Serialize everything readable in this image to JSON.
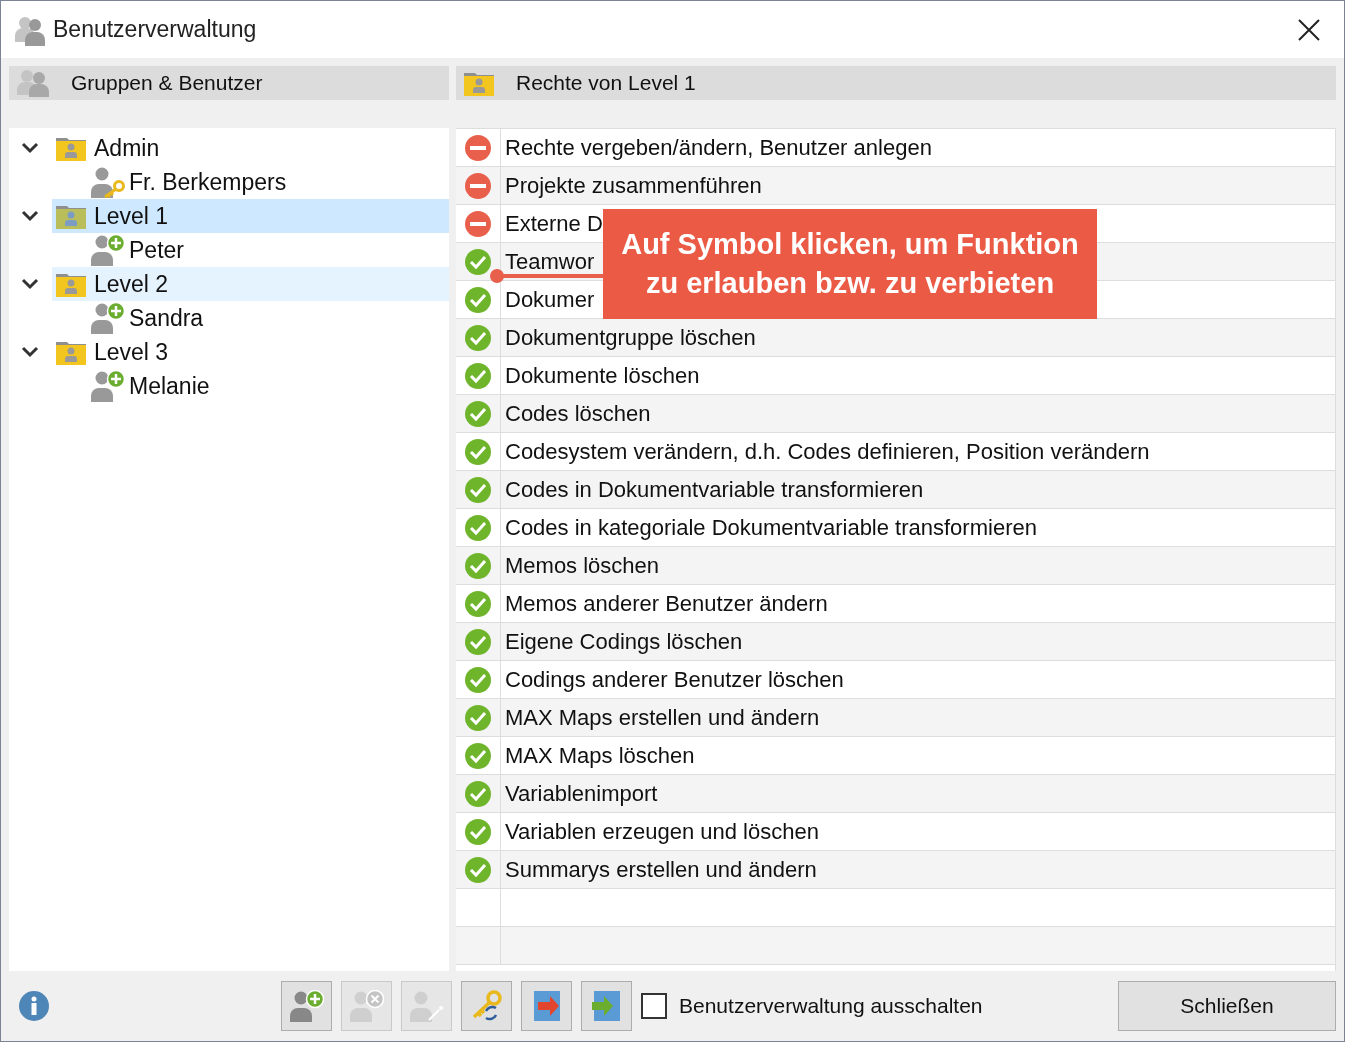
{
  "window": {
    "title": "Benutzerverwaltung"
  },
  "left_panel": {
    "header": "Gruppen & Benutzer"
  },
  "tree": [
    {
      "label": "Admin",
      "expanded": true,
      "selected": false,
      "hovered": false,
      "children": [
        {
          "label": "Fr. Berkempers",
          "kind": "owner"
        }
      ]
    },
    {
      "label": "Level 1",
      "expanded": true,
      "selected": true,
      "hovered": false,
      "children": [
        {
          "label": "Peter",
          "kind": "user"
        }
      ]
    },
    {
      "label": "Level 2",
      "expanded": true,
      "selected": false,
      "hovered": true,
      "children": [
        {
          "label": "Sandra",
          "kind": "user"
        }
      ]
    },
    {
      "label": "Level 3",
      "expanded": true,
      "selected": false,
      "hovered": false,
      "children": [
        {
          "label": "Melanie",
          "kind": "user"
        }
      ]
    }
  ],
  "right_panel": {
    "header": "Rechte von Level 1"
  },
  "rights": [
    {
      "label": "Rechte vergeben/ändern, Benutzer anlegen",
      "allowed": false
    },
    {
      "label": "Projekte zusammenführen",
      "allowed": false
    },
    {
      "label": "Externe D",
      "allowed": false
    },
    {
      "label": "Teamwor",
      "allowed": true
    },
    {
      "label": "Dokumer",
      "allowed": true
    },
    {
      "label": "Dokumentgruppe löschen",
      "allowed": true
    },
    {
      "label": "Dokumente löschen",
      "allowed": true
    },
    {
      "label": "Codes löschen",
      "allowed": true
    },
    {
      "label": "Codesystem verändern, d.h. Codes definieren, Position verändern",
      "allowed": true
    },
    {
      "label": "Codes in Dokumentvariable transformieren",
      "allowed": true
    },
    {
      "label": "Codes in kategoriale Dokumentvariable transformieren",
      "allowed": true
    },
    {
      "label": "Memos löschen",
      "allowed": true
    },
    {
      "label": "Memos anderer Benutzer ändern",
      "allowed": true
    },
    {
      "label": "Eigene Codings löschen",
      "allowed": true
    },
    {
      "label": "Codings anderer Benutzer löschen",
      "allowed": true
    },
    {
      "label": "MAX Maps erstellen und ändern",
      "allowed": true
    },
    {
      "label": "MAX Maps löschen",
      "allowed": true
    },
    {
      "label": "Variablenimport",
      "allowed": true
    },
    {
      "label": "Variablen erzeugen und löschen",
      "allowed": true
    },
    {
      "label": "Summarys erstellen und ändern",
      "allowed": true
    }
  ],
  "callout": {
    "text": "Auf Symbol klicken, um Funktion zu erlauben bzw. zu verbieten"
  },
  "toolbar": [
    {
      "kind": "add-user",
      "disabled": false
    },
    {
      "kind": "remove-user",
      "disabled": true
    },
    {
      "kind": "edit-user",
      "disabled": true
    },
    {
      "kind": "key",
      "disabled": false
    },
    {
      "kind": "export",
      "disabled": false
    },
    {
      "kind": "import",
      "disabled": false
    }
  ],
  "disable_checkbox": {
    "label": "Benutzerverwaltung ausschalten",
    "checked": false
  },
  "close_button": "Schließen"
}
